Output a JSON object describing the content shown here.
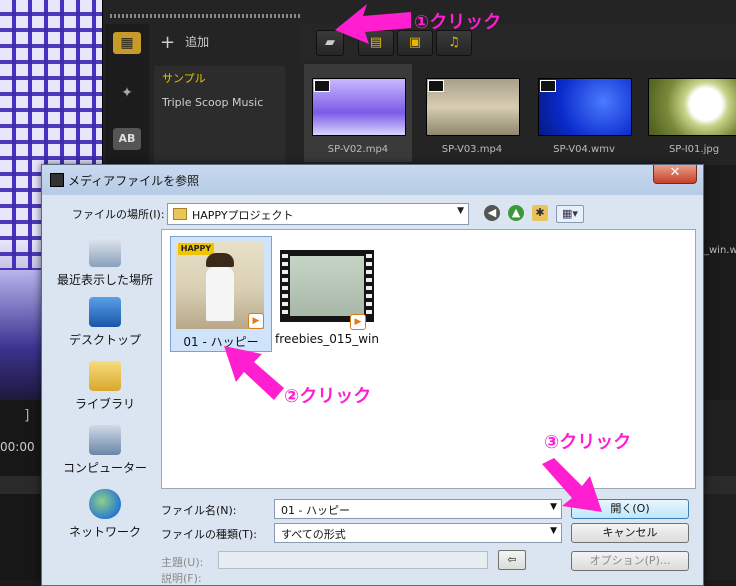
{
  "editor": {
    "add_label": "追加",
    "library_items": [
      "サンプル",
      "Triple Scoop Music"
    ],
    "thumbnails": [
      "SP-V02.mp4",
      "SP-V03.mp4",
      "SP-V04.wmv",
      "SP-I01.jpg"
    ],
    "side_tab_text": "AB",
    "timeline_peek_left": "00:00",
    "timeline_right_peek": "_win.wmv"
  },
  "dialog": {
    "title": "メディアファイルを参照",
    "close_glyph": "✕",
    "location_label": "ファイルの場所(I):",
    "location_value": "HAPPYプロジェクト",
    "places": [
      "最近表示した場所",
      "デスクトップ",
      "ライブラリ",
      "コンピューター",
      "ネットワーク"
    ],
    "files": [
      {
        "name": "01 - ハッピー",
        "thumb_text": "HAPPY"
      },
      {
        "name": "freebies_015_win"
      }
    ],
    "filename_label": "ファイル名(N):",
    "filename_value": "01 - ハッピー",
    "filetype_label": "ファイルの種類(T):",
    "filetype_value": "すべての形式",
    "subject_label": "主題(U):",
    "desc_label": "説明(F):",
    "open_button": "開く(O)",
    "cancel_button": "キャンセル",
    "options_button": "オプション(P)..."
  },
  "annotations": {
    "step1": "①クリック",
    "step2": "②クリック",
    "step3": "③クリック",
    "color": "#ff1fd0"
  }
}
